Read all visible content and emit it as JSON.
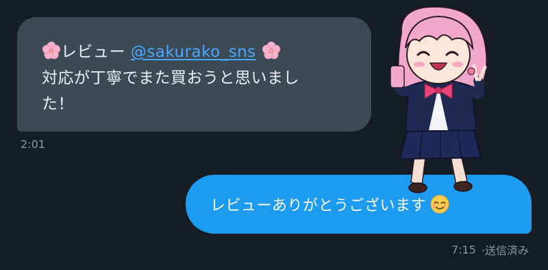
{
  "incoming": {
    "prefix": "レビュー",
    "mention": "@sakurako_sns",
    "line2": "対応が丁寧でまた買おうと思いまし",
    "line3": "た！",
    "emoji_icon": "cherry-blossom-icon",
    "time": "2:01"
  },
  "outgoing": {
    "text": "レビューありがとうございます",
    "emoji_icon": "smiling-face-icon",
    "time": "7:15",
    "status": "·送信済み"
  },
  "sticker": {
    "name": "pink-hair-girl-sticker"
  },
  "colors": {
    "background": "#151c24",
    "incoming_bubble": "#3c4a56",
    "outgoing_bubble": "#1d9bf0",
    "mention": "#48a8ff",
    "meta_text": "#8b96a1"
  }
}
